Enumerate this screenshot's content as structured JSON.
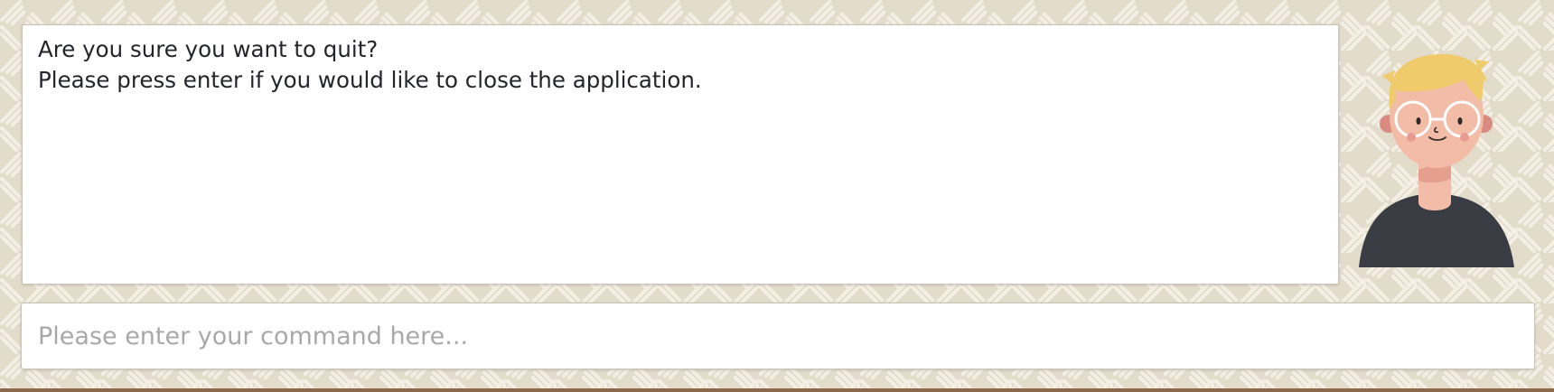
{
  "dialog": {
    "lines": [
      "Are you sure you want to quit?",
      "Please press enter if you would like to close the application."
    ]
  },
  "command_input": {
    "value": "",
    "placeholder": "Please enter your command here..."
  },
  "avatar": {
    "icon": "user-avatar-illustration",
    "colors": {
      "hair": "#efcb6c",
      "skin": "#f2bca7",
      "shirt": "#393c43"
    }
  },
  "colors": {
    "background": "#e4dccb",
    "pattern": "#f4efe4"
  }
}
